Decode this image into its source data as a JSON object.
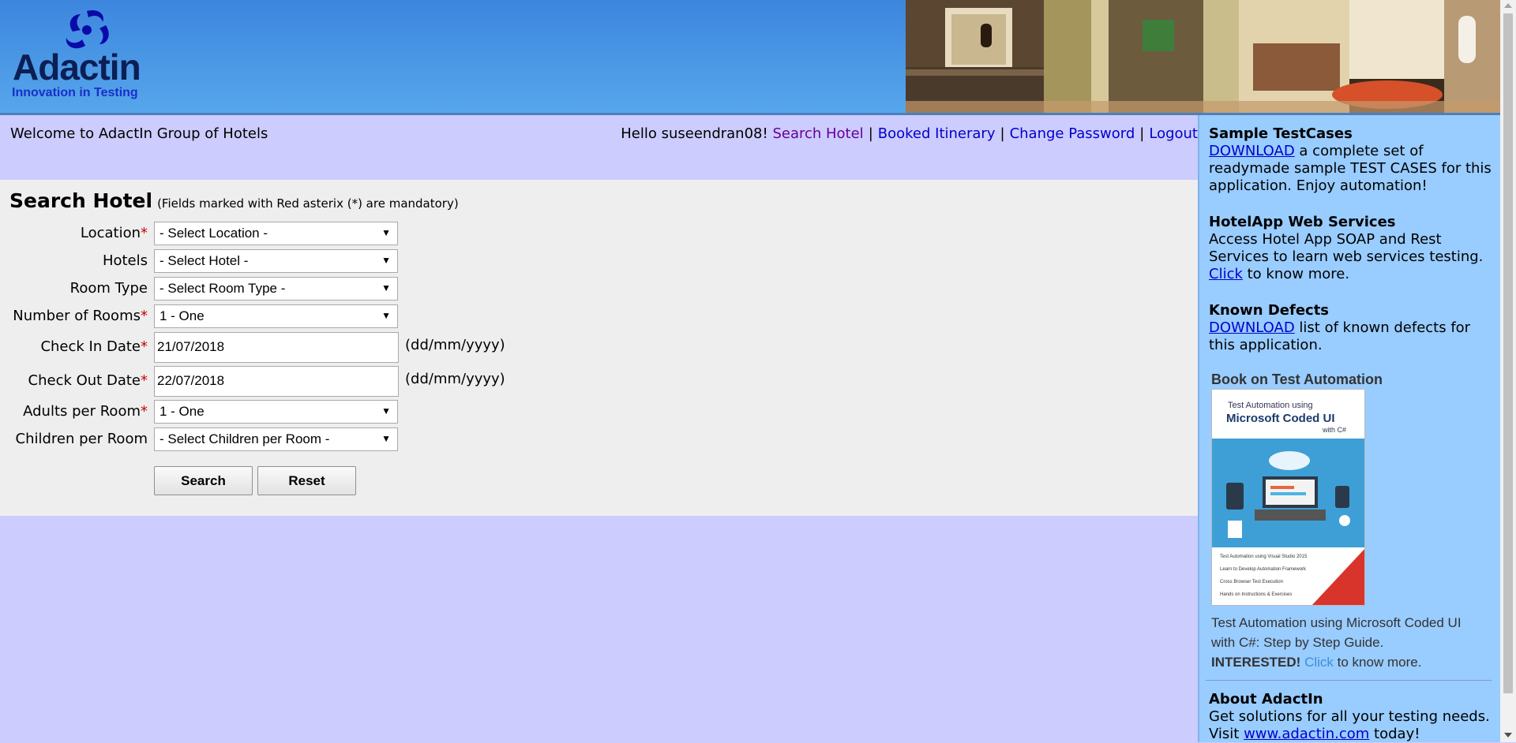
{
  "header": {
    "logo_word": "Adactin",
    "logo_tagline": "Innovation in Testing"
  },
  "welcome": {
    "text": "Welcome to AdactIn Group of Hotels"
  },
  "user_nav": {
    "greeting": "Hello suseendran08!",
    "links": [
      "Search Hotel",
      "Booked Itinerary",
      "Change Password",
      "Logout"
    ],
    "separator": "|"
  },
  "form": {
    "title": "Search Hotel",
    "mandatory_note": "(Fields marked with Red asterix (*) are mandatory)",
    "required_mark": "*",
    "fields": {
      "location": {
        "label": "Location",
        "value": "- Select Location -"
      },
      "hotels": {
        "label": "Hotels",
        "value": "- Select Hotel -"
      },
      "room_type": {
        "label": "Room Type",
        "value": "- Select Room Type -"
      },
      "rooms": {
        "label": "Number of Rooms",
        "value": "1 - One"
      },
      "check_in": {
        "label": "Check In Date",
        "value": "21/07/2018",
        "hint": "(dd/mm/yyyy)"
      },
      "check_out": {
        "label": "Check Out Date",
        "value": "22/07/2018",
        "hint": "(dd/mm/yyyy)"
      },
      "adults": {
        "label": "Adults per Room",
        "value": "1 - One"
      },
      "children": {
        "label": "Children per Room",
        "value": "- Select Children per Room -"
      }
    },
    "search_label": "Search",
    "reset_label": "Reset"
  },
  "sidebar": {
    "testcases": {
      "title": "Sample TestCases",
      "link": "DOWNLOAD",
      "text": " a complete set of readymade sample TEST CASES for this application. Enjoy automation!"
    },
    "webservices": {
      "title": "HotelApp Web Services",
      "text": "Access Hotel App SOAP and Rest Services to learn web services testing.",
      "link": "Click",
      "text_after": " to know more."
    },
    "defects": {
      "title": "Known Defects",
      "link": "DOWNLOAD",
      "text": " list of known defects for this application."
    },
    "book": {
      "title": "Book on Test Automation",
      "cover_line1": "Test Automation using",
      "cover_line2": "Microsoft Coded UI",
      "cover_line3": "with C#",
      "cover_items": [
        "Test Automation using Visual Studio 2015",
        "Learn to Develop Automation Framework",
        "Cross Browser Test Execution",
        "Hands on Instructions & Exercises"
      ],
      "desc": "Test Automation using Microsoft Coded UI with C#: Step by Step Guide.",
      "interested": "INTERESTED!",
      "link": "Click",
      "text_after": " to know more."
    },
    "about": {
      "title": "About AdactIn",
      "text": "Get solutions for all your testing needs.",
      "visit": "Visit ",
      "link": "www.adactin.com",
      "text_after": " today!"
    }
  },
  "colors": {
    "page_bg": "#ccccff",
    "header_blue": "#56a6ec",
    "form_bg": "#eeeeee",
    "sidebar_bg": "#99ccff",
    "link": "#0000cc",
    "visited_link": "#660099",
    "required": "#cc0000"
  }
}
